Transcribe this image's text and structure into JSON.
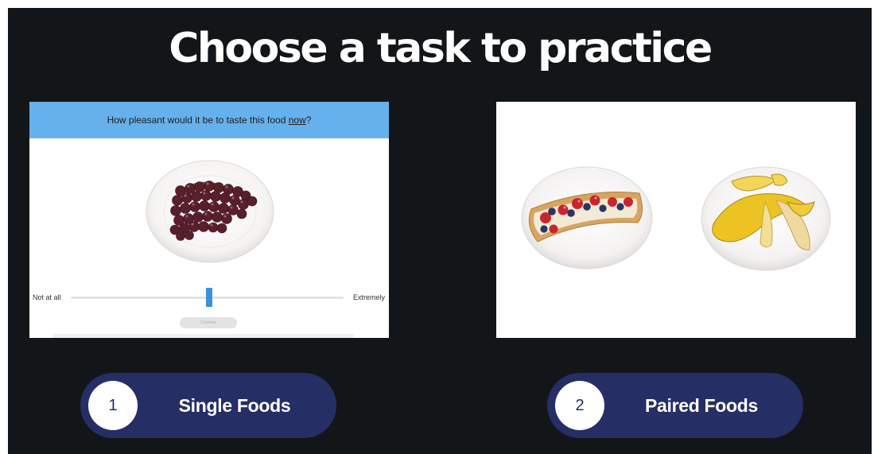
{
  "page": {
    "title": "Choose a task to practice"
  },
  "single_task": {
    "question_prefix": "How pleasant would it be to taste this food ",
    "question_emphasis": "now",
    "question_suffix": "?",
    "scale_min_label": "Not at all",
    "scale_max_label": "Extremely",
    "rating_value_fraction": 0.5,
    "continue_label": "Continue",
    "food_image": "grapes-on-plate"
  },
  "paired_task": {
    "food_images": [
      "crepe-with-berries-on-plate",
      "banana-on-plate"
    ]
  },
  "options": [
    {
      "number": "1",
      "label": "Single Foods"
    },
    {
      "number": "2",
      "label": "Paired Foods"
    }
  ],
  "colors": {
    "background": "#131619",
    "pill": "#262e66",
    "prompt_bar": "#66b0eb",
    "slider_thumb": "#3f8fd9",
    "title_text": "#ffffff"
  }
}
